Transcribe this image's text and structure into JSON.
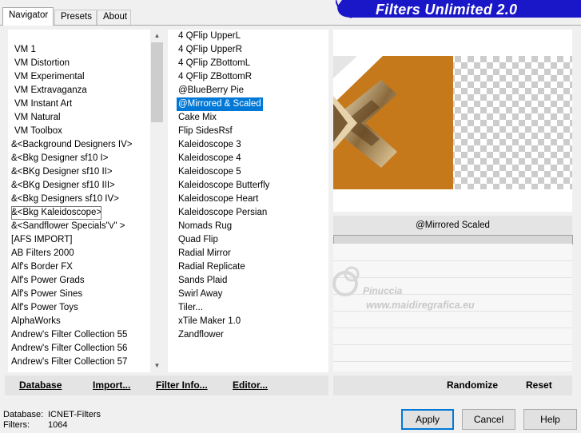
{
  "tabs": [
    {
      "label": "Navigator",
      "active": true
    },
    {
      "label": "Presets",
      "active": false
    },
    {
      "label": "About",
      "active": false
    }
  ],
  "header": {
    "title": "Filters Unlimited 2.0",
    "accent": "#1a17c8"
  },
  "categories": {
    "items": [
      "VM 1",
      "VM Distortion",
      "VM Experimental",
      "VM Extravaganza",
      "VM Instant Art",
      "VM Natural",
      "VM Toolbox",
      "&<Background Designers IV>",
      "&<Bkg Designer sf10 I>",
      "&<BKg Designer sf10 II>",
      "&<BKg Designer sf10 III>",
      "&<Bkg Designers sf10 IV>",
      "&<Bkg Kaleidoscope>",
      "&<Sandflower Specials\"v\" >",
      "[AFS IMPORT]",
      "AB Filters 2000",
      "Alf's Border FX",
      "Alf's Power Grads",
      "Alf's Power Sines",
      "Alf's Power Toys",
      "AlphaWorks",
      "Andrew's Filter Collection 55",
      "Andrew's Filter Collection 56",
      "Andrew's Filter Collection 57"
    ],
    "highlighted_index": 12
  },
  "filters": {
    "items": [
      "4 QFlip UpperL",
      "4 QFlip UpperR",
      "4 QFlip ZBottomL",
      "4 QFlip ZBottomR",
      "@BlueBerry Pie",
      "@Mirrored & Scaled",
      "Cake Mix",
      "Flip SidesRsf",
      "Kaleidoscope 3",
      "Kaleidoscope 4",
      "Kaleidoscope 5",
      "Kaleidoscope Butterfly",
      "Kaleidoscope Heart",
      "Kaleidoscope Persian",
      "Nomads Rug",
      "Quad Flip",
      "Radial Mirror",
      "Radial Replicate",
      "Sands Plaid",
      "Swirl Away",
      "Tiler...",
      "xTile Maker 1.0",
      "Zandflower"
    ],
    "selected_index": 5
  },
  "left_toolbar": {
    "database": "Database",
    "import": "Import...",
    "filter_info": "Filter Info...",
    "editor": "Editor..."
  },
  "preview": {
    "filter_name": "@Mirrored  Scaled",
    "watermark_name": "Pinuccia",
    "watermark_url": "www.maidiregrafica.eu"
  },
  "right_toolbar": {
    "randomize": "Randomize",
    "reset": "Reset"
  },
  "status": {
    "database_label": "Database:",
    "database_value": "ICNET-Filters",
    "filters_label": "Filters:",
    "filters_value": "1064"
  },
  "buttons": {
    "apply": "Apply",
    "cancel": "Cancel",
    "help": "Help"
  },
  "colors": {
    "selection": "#0078d7",
    "preview_orange": "#c6791a",
    "panel_bg": "#ffffff"
  }
}
